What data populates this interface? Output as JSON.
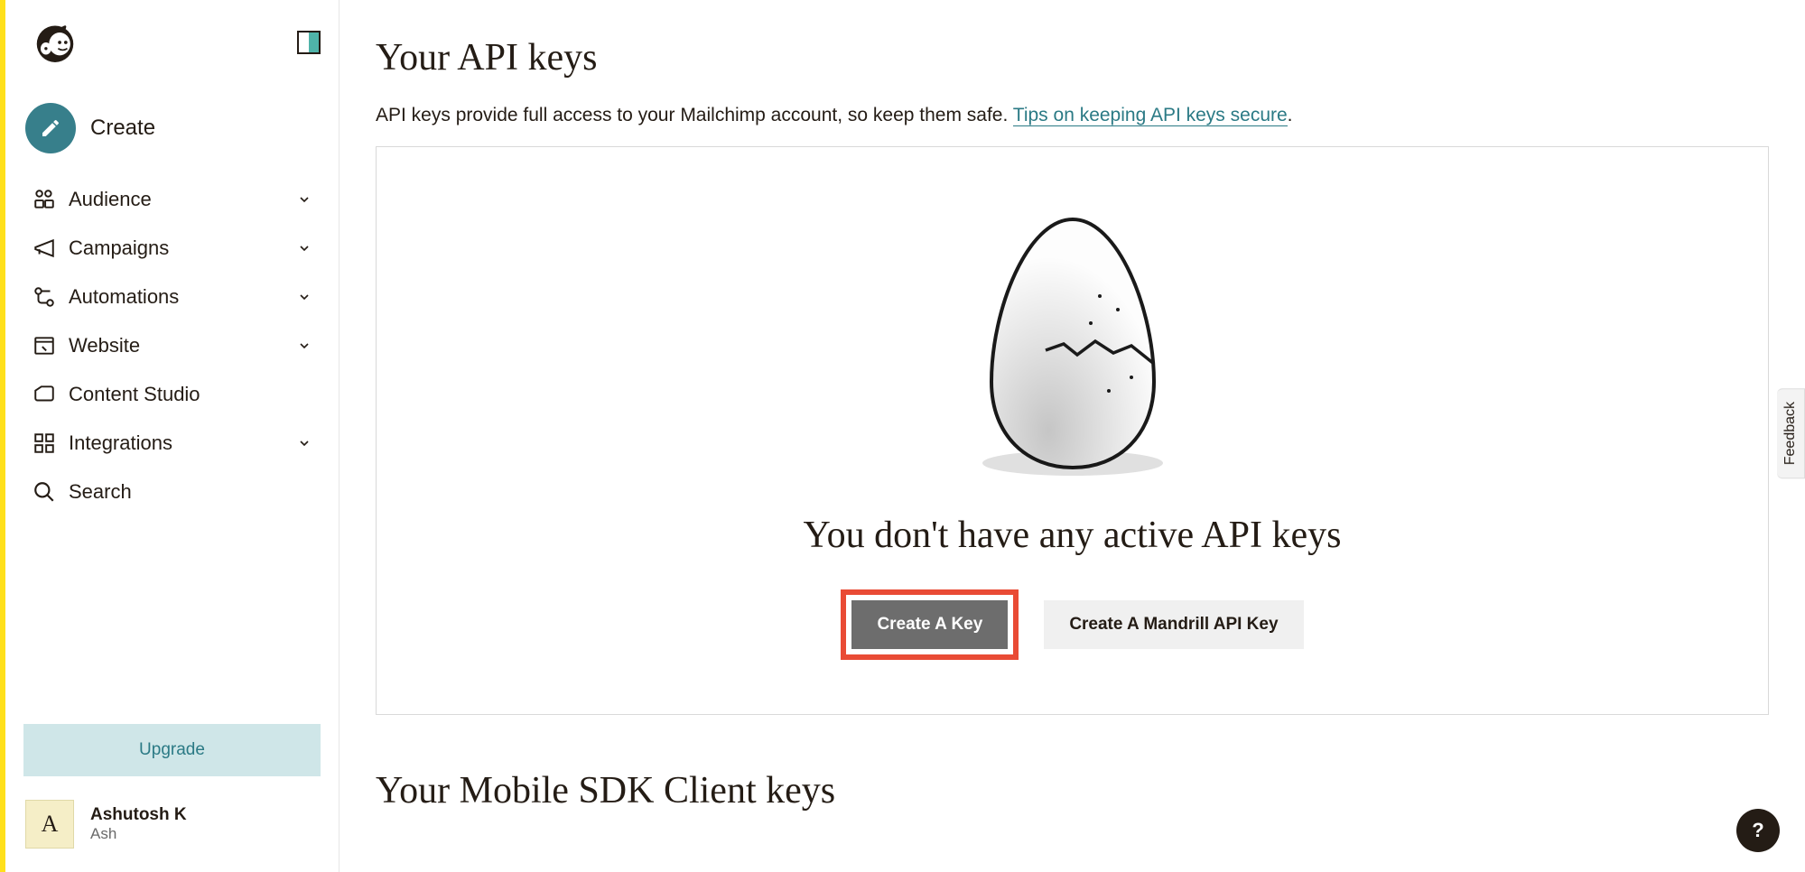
{
  "sidebar": {
    "create_label": "Create",
    "items": [
      {
        "label": "Audience",
        "icon": "audience-icon",
        "expandable": true
      },
      {
        "label": "Campaigns",
        "icon": "campaigns-icon",
        "expandable": true
      },
      {
        "label": "Automations",
        "icon": "automations-icon",
        "expandable": true
      },
      {
        "label": "Website",
        "icon": "website-icon",
        "expandable": true
      },
      {
        "label": "Content Studio",
        "icon": "content-studio-icon",
        "expandable": false
      },
      {
        "label": "Integrations",
        "icon": "integrations-icon",
        "expandable": true
      },
      {
        "label": "Search",
        "icon": "search-icon",
        "expandable": false
      }
    ],
    "upgrade_label": "Upgrade",
    "user": {
      "name": "Ashutosh K",
      "sub": "Ash",
      "initial": "A"
    }
  },
  "main": {
    "title": "Your API keys",
    "desc_prefix": "API keys provide full access to your Mailchimp account, so keep them safe. ",
    "desc_link": "Tips on keeping API keys secure",
    "desc_suffix": ".",
    "empty_title": "You don't have any active API keys",
    "create_key_btn": "Create A Key",
    "create_mandrill_btn": "Create A Mandrill API Key",
    "sdk_title": "Your Mobile SDK Client keys"
  },
  "ui": {
    "feedback_label": "Feedback",
    "help_label": "?"
  }
}
